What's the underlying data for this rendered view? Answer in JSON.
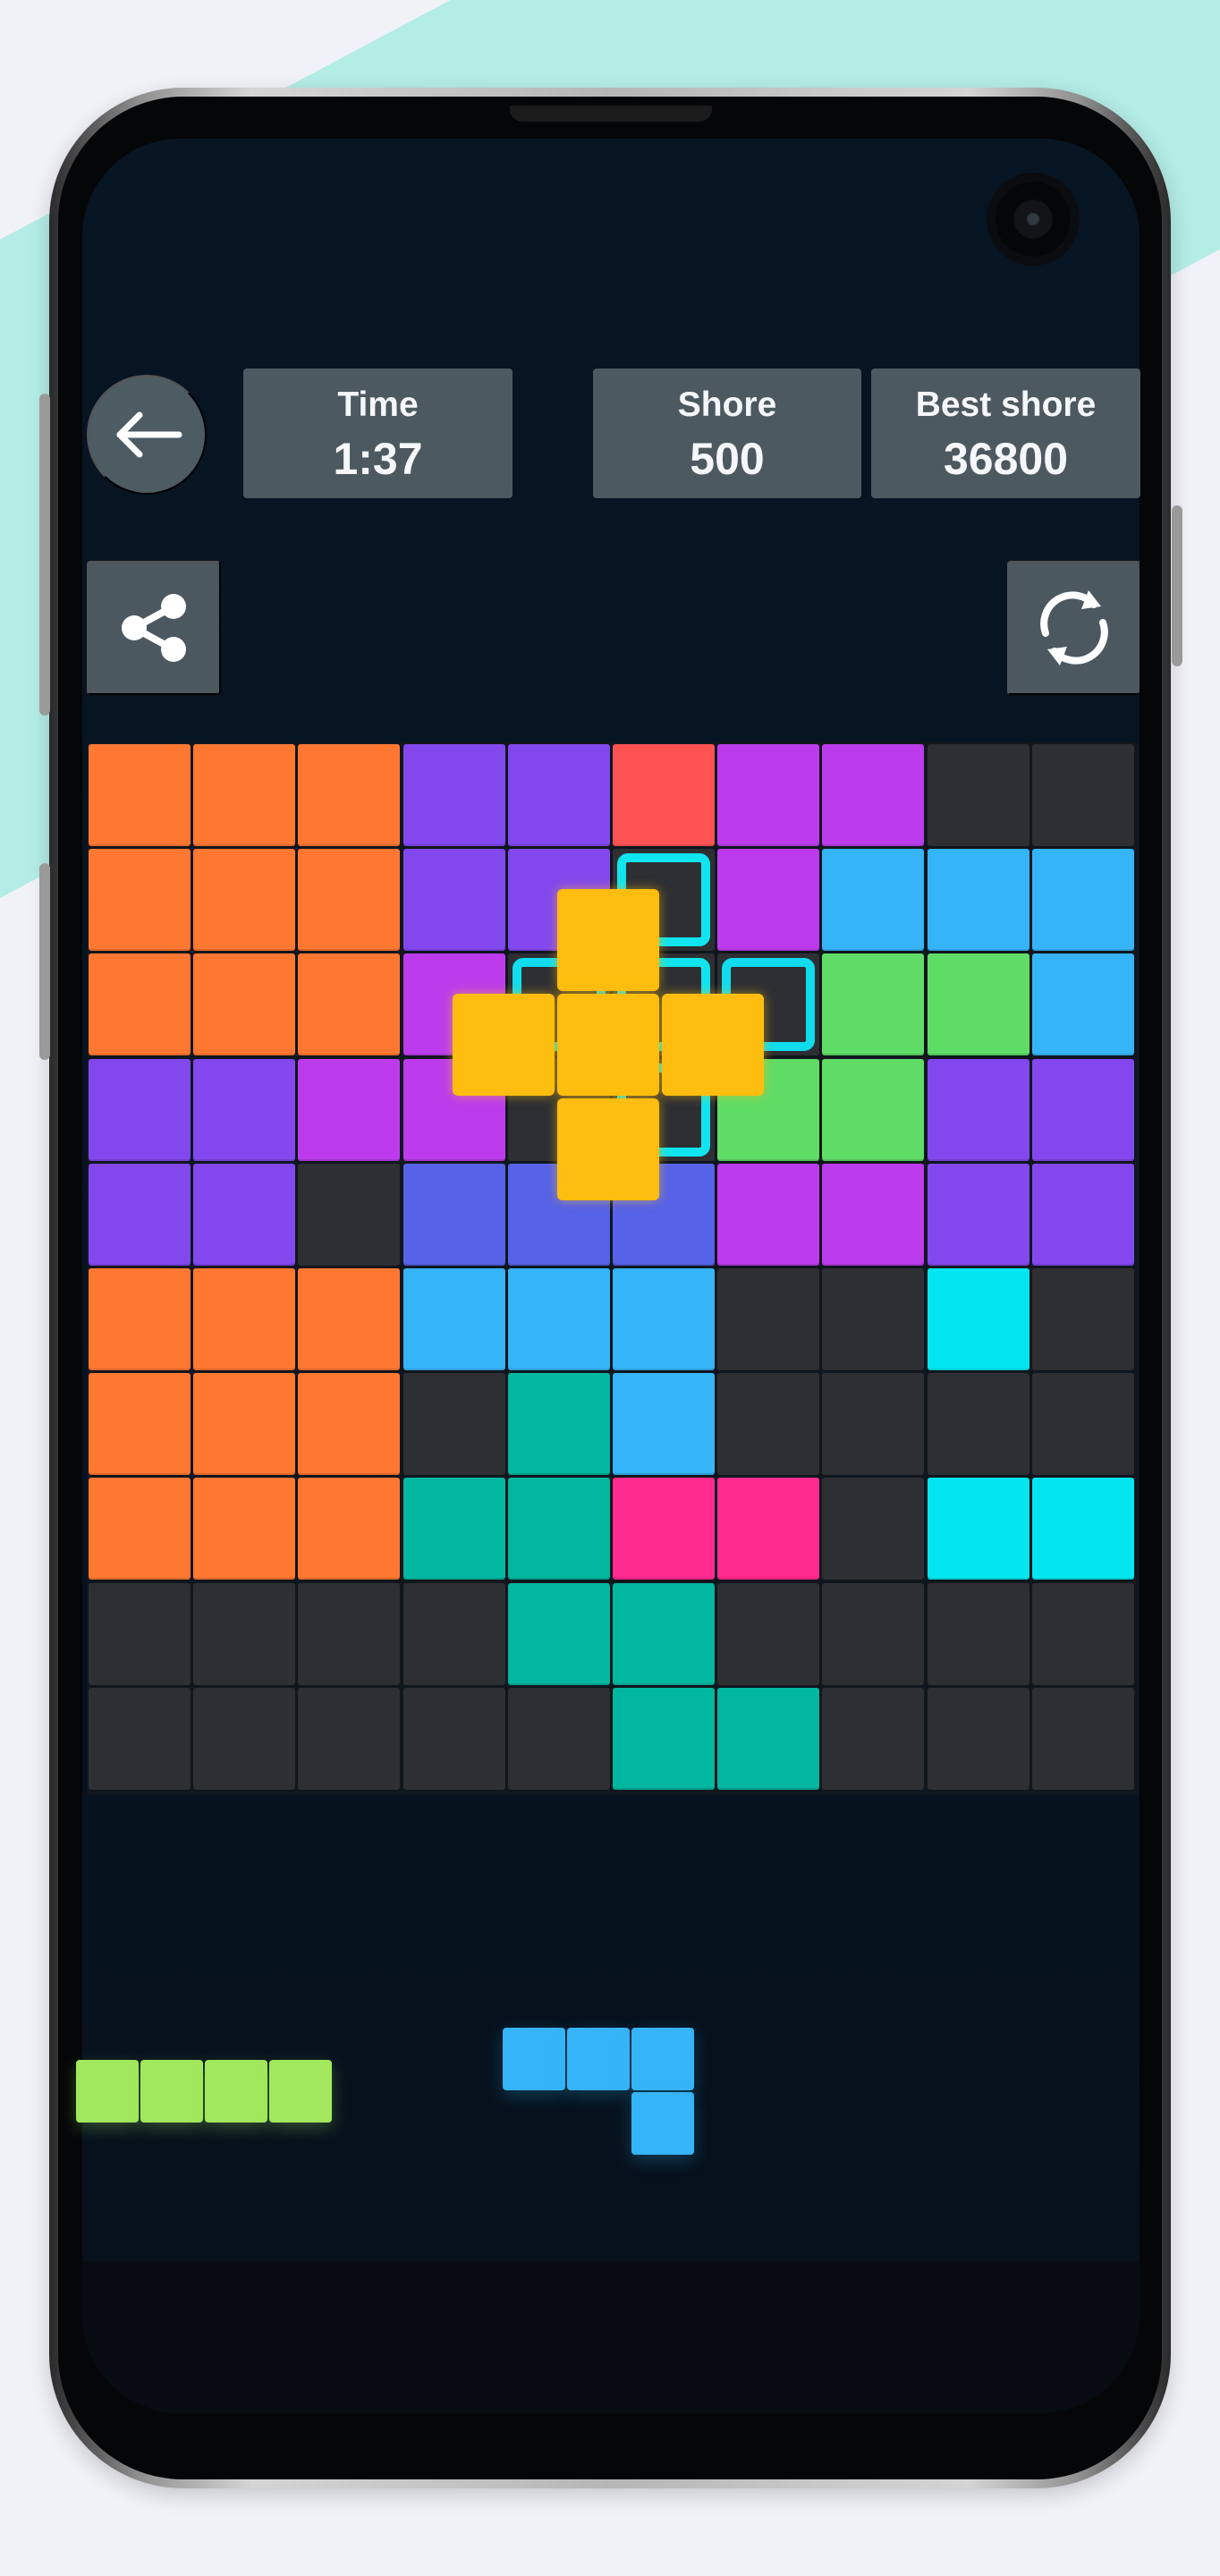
{
  "game": {
    "stats": {
      "time_label": "Time",
      "time_value": "1:37",
      "score_label": "Shore",
      "score_value": "500",
      "best_label": "Best shore",
      "best_value": "36800"
    },
    "icons": {
      "back": "arrow-left-icon",
      "share": "share-icon",
      "restart": "refresh-icon"
    },
    "palette": {
      "empty": "#2d2f33",
      "orange": "#ff7832",
      "purple": "#8248ee",
      "magenta": "#bc3ced",
      "red": "#ff5252",
      "blue": "#36b4f8",
      "green": "#5fdc66",
      "indigo": "#5662e7",
      "cyan": "#03e6f0",
      "teal": "#01b7a0",
      "pink": "#ff2b8f",
      "gold": "#ffbe0f",
      "lime": "#a2e85d"
    },
    "board": [
      [
        "orange",
        "orange",
        "orange",
        "purple",
        "purple",
        "red",
        "magenta",
        "magenta",
        "empty",
        "empty"
      ],
      [
        "orange",
        "orange",
        "orange",
        "purple",
        "purple",
        "empty",
        "magenta",
        "blue",
        "blue",
        "blue"
      ],
      [
        "orange",
        "orange",
        "orange",
        "magenta",
        "empty",
        "empty",
        "empty",
        "green",
        "green",
        "blue"
      ],
      [
        "purple",
        "purple",
        "magenta",
        "magenta",
        "empty",
        "empty",
        "green",
        "green",
        "purple",
        "purple"
      ],
      [
        "purple",
        "purple",
        "empty",
        "indigo",
        "indigo",
        "indigo",
        "magenta",
        "magenta",
        "purple",
        "purple"
      ],
      [
        "orange",
        "orange",
        "orange",
        "blue",
        "blue",
        "blue",
        "empty",
        "empty",
        "cyan",
        "empty"
      ],
      [
        "orange",
        "orange",
        "orange",
        "empty",
        "teal",
        "blue",
        "empty",
        "empty",
        "empty",
        "empty"
      ],
      [
        "orange",
        "orange",
        "orange",
        "teal",
        "teal",
        "pink",
        "pink",
        "empty",
        "cyan",
        "cyan"
      ],
      [
        "empty",
        "empty",
        "empty",
        "empty",
        "teal",
        "teal",
        "empty",
        "empty",
        "empty",
        "empty"
      ],
      [
        "empty",
        "empty",
        "empty",
        "empty",
        "empty",
        "teal",
        "teal",
        "empty",
        "empty",
        "empty"
      ]
    ],
    "ghost_slots": [
      {
        "row": 1,
        "col": 5
      },
      {
        "row": 2,
        "col": 4
      },
      {
        "row": 2,
        "col": 5
      },
      {
        "row": 2,
        "col": 6
      },
      {
        "row": 3,
        "col": 5
      }
    ],
    "drag_piece": {
      "color": "gold",
      "cells": [
        {
          "row": 0,
          "col": 1
        },
        {
          "row": 1,
          "col": 0
        },
        {
          "row": 1,
          "col": 1
        },
        {
          "row": 1,
          "col": 2
        },
        {
          "row": 2,
          "col": 1
        }
      ]
    },
    "tray": [
      {
        "name": "tray-piece-lime-line",
        "color": "lime",
        "cells": [
          {
            "row": 0,
            "col": 0
          },
          {
            "row": 0,
            "col": 1
          },
          {
            "row": 0,
            "col": 2
          },
          {
            "row": 0,
            "col": 3
          }
        ]
      },
      {
        "name": "tray-piece-blue-l",
        "color": "blue",
        "cells": [
          {
            "row": 0,
            "col": 0
          },
          {
            "row": 0,
            "col": 1
          },
          {
            "row": 0,
            "col": 2
          },
          {
            "row": 1,
            "col": 2
          }
        ]
      }
    ]
  }
}
